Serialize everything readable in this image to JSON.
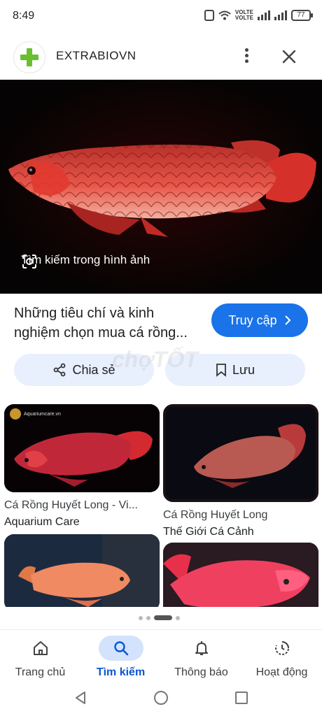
{
  "status_bar": {
    "time": "8:49",
    "volte1": "VOLTE",
    "volte2": "VOLTE",
    "battery": "77"
  },
  "header": {
    "site_name": "EXTRABIOVN",
    "logo_icon": "green-plus-icon",
    "more_icon": "more-vert-icon",
    "close_icon": "close-icon"
  },
  "hero": {
    "lens_label": "Tìm kiếm trong hình ảnh",
    "lens_icon": "google-lens-icon"
  },
  "result": {
    "title": "Những tiêu chí và kinh nghiệm chọn mua cá rồng...",
    "visit_label": "Truy cập"
  },
  "actions": {
    "share_label": "Chia sẻ",
    "save_label": "Lưu",
    "watermark": "chợTỐT"
  },
  "related": [
    {
      "title": "Cá Rồng Huyết Long - Vi...",
      "source": "Aquarium Care",
      "badge": "Aquariumcare.vn"
    },
    {
      "title": "Cá Rồng Huyết Long",
      "source": "Thế Giới Cá Cảnh"
    },
    {
      "title": "",
      "source": ""
    },
    {
      "title": "",
      "source": ""
    }
  ],
  "bottom_nav": [
    {
      "label": "Trang chủ",
      "icon": "home-icon",
      "active": false
    },
    {
      "label": "Tìm kiếm",
      "icon": "search-icon",
      "active": true
    },
    {
      "label": "Thông báo",
      "icon": "bell-icon",
      "active": false
    },
    {
      "label": "Hoạt động",
      "icon": "activity-icon",
      "active": false
    }
  ],
  "colors": {
    "accent": "#1a73e8",
    "chip_bg": "#e8f0fe",
    "nav_active_bg": "#d3e3fd",
    "logo_green": "#6abf2e",
    "fish_red": "#d8332a"
  }
}
